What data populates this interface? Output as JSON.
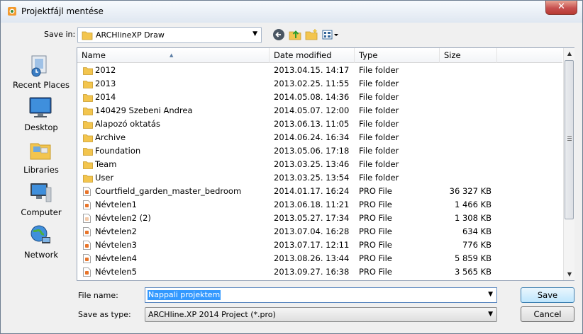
{
  "window": {
    "title": "Projektfájl mentése",
    "close_glyph": "✕"
  },
  "toolbar": {
    "save_in_label": "Save in:",
    "save_in_value": "ARCHlineXP Draw",
    "back_icon": "back-arrow-icon",
    "up_icon": "up-folder-icon",
    "new_folder_icon": "new-folder-icon",
    "view_icon": "view-menu-icon"
  },
  "places": [
    {
      "label": "Recent Places",
      "icon": "recent-places-icon"
    },
    {
      "label": "Desktop",
      "icon": "desktop-icon"
    },
    {
      "label": "Libraries",
      "icon": "libraries-icon"
    },
    {
      "label": "Computer",
      "icon": "computer-icon"
    },
    {
      "label": "Network",
      "icon": "network-icon"
    }
  ],
  "columns": {
    "name": "Name",
    "date": "Date modified",
    "type": "Type",
    "size": "Size"
  },
  "files": [
    {
      "name": "2012",
      "date": "2013.04.15. 14:17",
      "type": "File folder",
      "size": "",
      "kind": "folder"
    },
    {
      "name": "2013",
      "date": "2013.02.25. 11:55",
      "type": "File folder",
      "size": "",
      "kind": "folder"
    },
    {
      "name": "2014",
      "date": "2014.05.08. 14:36",
      "type": "File folder",
      "size": "",
      "kind": "folder"
    },
    {
      "name": "140429 Szebeni Andrea",
      "date": "2014.05.07. 12:00",
      "type": "File folder",
      "size": "",
      "kind": "folder"
    },
    {
      "name": "Alapozó oktatás",
      "date": "2013.06.13. 11:05",
      "type": "File folder",
      "size": "",
      "kind": "folder"
    },
    {
      "name": "Archive",
      "date": "2014.06.24. 16:34",
      "type": "File folder",
      "size": "",
      "kind": "folder"
    },
    {
      "name": "Foundation",
      "date": "2013.05.06. 17:18",
      "type": "File folder",
      "size": "",
      "kind": "folder"
    },
    {
      "name": "Team",
      "date": "2013.03.25. 13:46",
      "type": "File folder",
      "size": "",
      "kind": "folder"
    },
    {
      "name": "User",
      "date": "2013.03.25. 13:54",
      "type": "File folder",
      "size": "",
      "kind": "folder"
    },
    {
      "name": "Courtfield_garden_master_bedroom",
      "date": "2014.01.17. 16:24",
      "type": "PRO File",
      "size": "36 327 KB",
      "kind": "pro"
    },
    {
      "name": "Névtelen1",
      "date": "2013.06.18. 11:21",
      "type": "PRO File",
      "size": "1 466 KB",
      "kind": "pro"
    },
    {
      "name": "Névtelen2 (2)",
      "date": "2013.05.27. 17:34",
      "type": "PRO File",
      "size": "1 308 KB",
      "kind": "pro-faded"
    },
    {
      "name": "Névtelen2",
      "date": "2013.07.04. 16:28",
      "type": "PRO File",
      "size": "634 KB",
      "kind": "pro"
    },
    {
      "name": "Névtelen3",
      "date": "2013.07.17. 12:11",
      "type": "PRO File",
      "size": "776 KB",
      "kind": "pro"
    },
    {
      "name": "Névtelen4",
      "date": "2013.08.26. 13:44",
      "type": "PRO File",
      "size": "5 859 KB",
      "kind": "pro"
    },
    {
      "name": "Névtelen5",
      "date": "2013.09.27. 16:38",
      "type": "PRO File",
      "size": "3 565 KB",
      "kind": "pro"
    }
  ],
  "form": {
    "file_name_label": "File name:",
    "file_name_value": "Nappali projektem",
    "save_as_type_label": "Save as type:",
    "save_as_type_value": "ARCHline.XP 2014 Project (*.pro)"
  },
  "buttons": {
    "save": "Save",
    "cancel": "Cancel"
  },
  "colors": {
    "selection": "#3399ff",
    "folder": "#f3c54e",
    "close": "#c75050"
  }
}
